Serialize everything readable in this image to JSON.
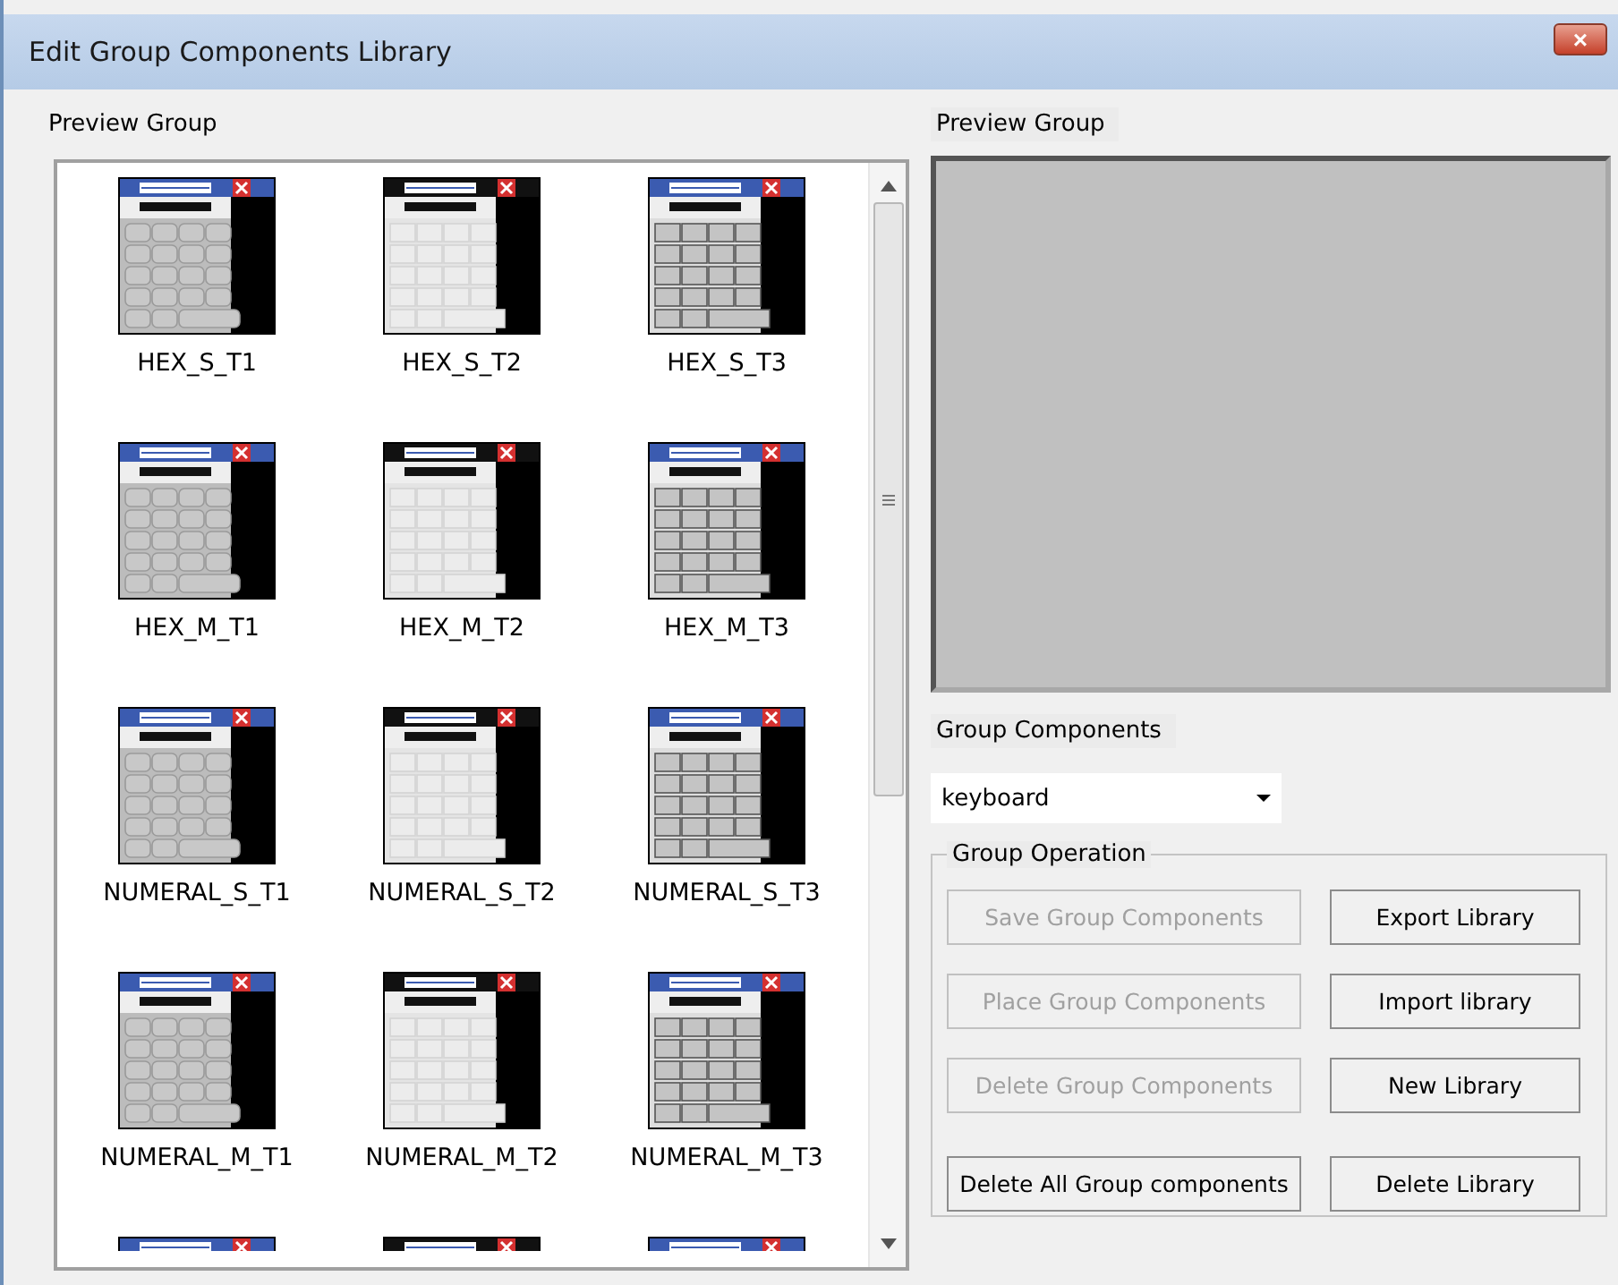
{
  "window": {
    "title": "Edit Group Components Library",
    "close": "×"
  },
  "preview_list": {
    "label": "Preview Group",
    "items": [
      {
        "name": "HEX_S_T1",
        "kind": "rounded"
      },
      {
        "name": "HEX_S_T2",
        "kind": "flat"
      },
      {
        "name": "HEX_S_T3",
        "kind": "boxed"
      },
      {
        "name": "HEX_M_T1",
        "kind": "rounded"
      },
      {
        "name": "HEX_M_T2",
        "kind": "flat"
      },
      {
        "name": "HEX_M_T3",
        "kind": "boxed"
      },
      {
        "name": "NUMERAL_S_T1",
        "kind": "rounded"
      },
      {
        "name": "NUMERAL_S_T2",
        "kind": "flat"
      },
      {
        "name": "NUMERAL_S_T3",
        "kind": "boxed"
      },
      {
        "name": "NUMERAL_M_T1",
        "kind": "rounded"
      },
      {
        "name": "NUMERAL_M_T2",
        "kind": "flat"
      },
      {
        "name": "NUMERAL_M_T3",
        "kind": "boxed"
      }
    ],
    "cut_off_items": [
      {
        "kind": "rounded"
      },
      {
        "kind": "flat"
      },
      {
        "kind": "boxed"
      }
    ]
  },
  "preview_pane": {
    "label": "Preview Group"
  },
  "group_components": {
    "label": "Group Components",
    "value": "keyboard"
  },
  "group_operation": {
    "label": "Group Operation",
    "buttons": [
      {
        "label": "Save Group Components",
        "disabled": true
      },
      {
        "label": "Export Library",
        "disabled": false
      },
      {
        "label": "Place Group Components",
        "disabled": true
      },
      {
        "label": "Import library",
        "disabled": false
      },
      {
        "label": "Delete Group Components",
        "disabled": true
      },
      {
        "label": "New Library",
        "disabled": false
      },
      {
        "label": "Delete All Group components",
        "disabled": false
      },
      {
        "label": "Delete Library",
        "disabled": false
      }
    ]
  }
}
